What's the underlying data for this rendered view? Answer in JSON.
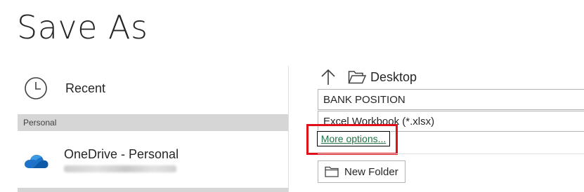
{
  "page": {
    "title": "Save As"
  },
  "left_panel": {
    "recent": {
      "label": "Recent",
      "icon": "clock-icon"
    },
    "section_header": "Personal",
    "onedrive": {
      "label": "OneDrive - Personal",
      "icon": "onedrive-cloud-icon"
    }
  },
  "right_panel": {
    "location": {
      "up_icon": "up-arrow-icon",
      "folder_icon": "folder-open-icon",
      "name": "Desktop"
    },
    "file_name": {
      "value": "BANK POSITION"
    },
    "file_type": {
      "value": "Excel Workbook (*.xlsx)"
    },
    "more_options_label": "More options...",
    "new_folder_label": "New Folder"
  },
  "colors": {
    "accent_link": "#217346",
    "highlight": "#e0101a",
    "onedrive_blue": "#1e73c8",
    "section_header_bg": "#d6d6d6"
  }
}
